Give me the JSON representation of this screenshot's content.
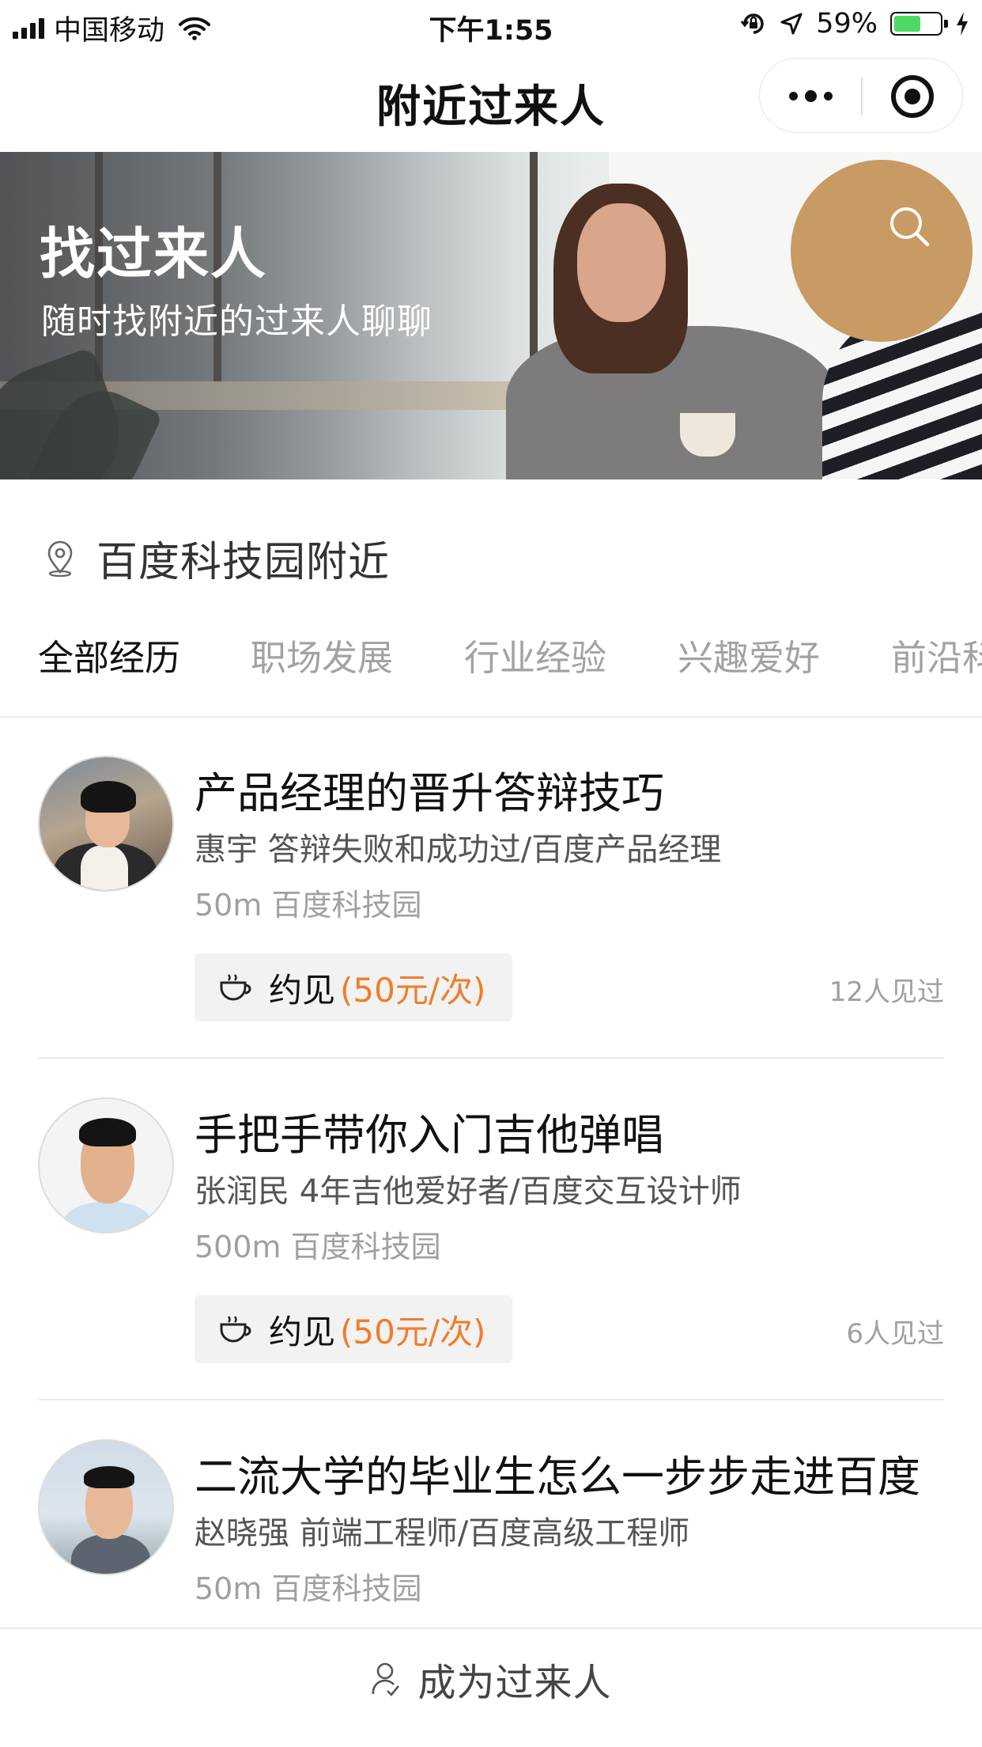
{
  "status_bar": {
    "carrier": "中国移动",
    "time": "下午1:55",
    "battery": "59%",
    "battery_level": 0.59
  },
  "navbar": {
    "title": "附近过来人"
  },
  "banner": {
    "title": "找过来人",
    "subtitle": "随时找附近的过来人聊聊"
  },
  "location": {
    "text": "百度科技园附近"
  },
  "tabs": [
    {
      "label": "全部经历",
      "active": true
    },
    {
      "label": "职场发展",
      "active": false
    },
    {
      "label": "行业经验",
      "active": false
    },
    {
      "label": "兴趣爱好",
      "active": false
    },
    {
      "label": "前沿科",
      "active": false
    }
  ],
  "items": [
    {
      "title": "产品经理的晋升答辩技巧",
      "description": "惠宇 答辩失败和成功过/百度产品经理",
      "location": "50m 百度科技园",
      "meet_label": "约见",
      "meet_price": "(50元/次)",
      "seen": "12人见过"
    },
    {
      "title": "手把手带你入门吉他弹唱",
      "description": "张润民 4年吉他爱好者/百度交互设计师",
      "location": "500m 百度科技园",
      "meet_label": "约见",
      "meet_price": "(50元/次)",
      "seen": "6人见过"
    },
    {
      "title": "二流大学的毕业生怎么一步步走进百度",
      "description": "赵晓强 前端工程师/百度高级工程师",
      "location": "50m 百度科技园"
    }
  ],
  "bottom_bar": {
    "label": "成为过来人"
  },
  "colors": {
    "accent_price": "#f07d2c",
    "battery_fill": "#4cd964"
  }
}
